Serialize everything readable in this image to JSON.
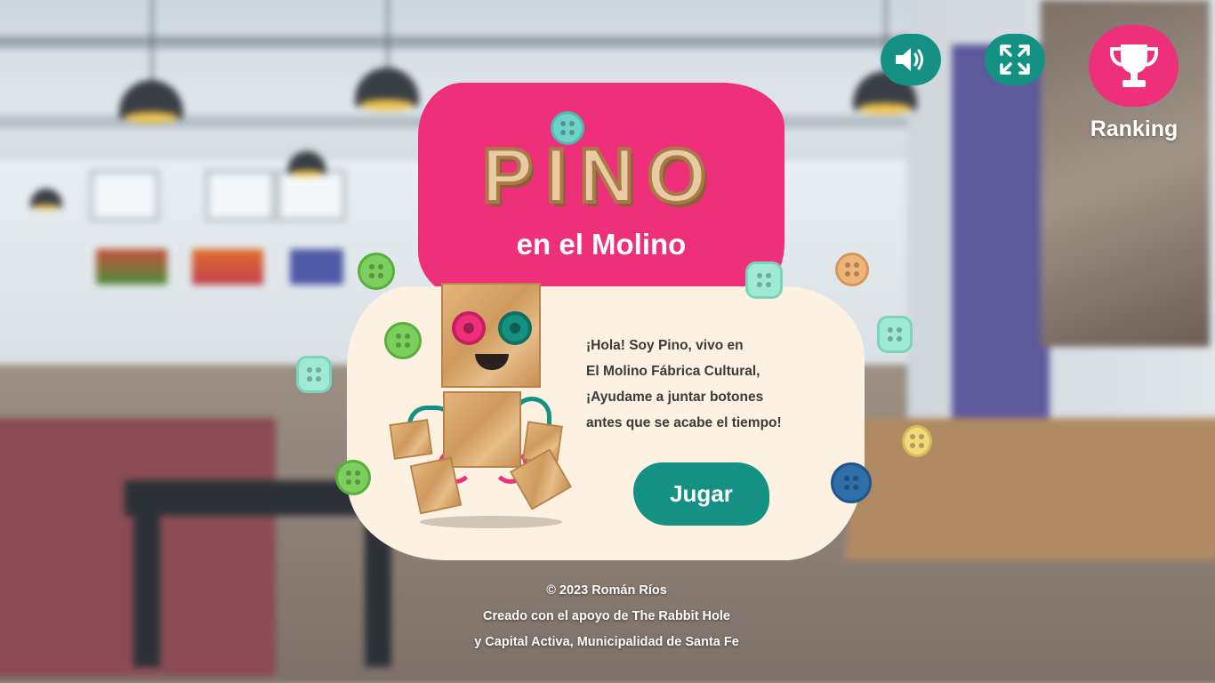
{
  "game": {
    "title": "PINO",
    "subtitle": "en el Molino"
  },
  "controls": {
    "sound_icon": "speaker-icon",
    "fullscreen_icon": "fullscreen-expand-icon",
    "ranking_icon": "trophy-icon",
    "ranking_label": "Ranking"
  },
  "intro": {
    "lines": [
      "¡Hola! Soy Pino, vivo en",
      "El Molino Fábrica Cultural,",
      "¡Ayudame a juntar botones",
      "antes que se acabe el tiempo!"
    ],
    "play_label": "Jugar"
  },
  "credits": {
    "copyright": "© 2023 Román Ríos",
    "support_line1": "Creado con el apoyo de The Rabbit Hole",
    "support_line2": "y Capital Activa, Municipalidad de Santa Fe"
  },
  "colors": {
    "accent_pink": "#ee2f79",
    "accent_teal": "#149182",
    "card_cream": "#fdf1e1"
  }
}
